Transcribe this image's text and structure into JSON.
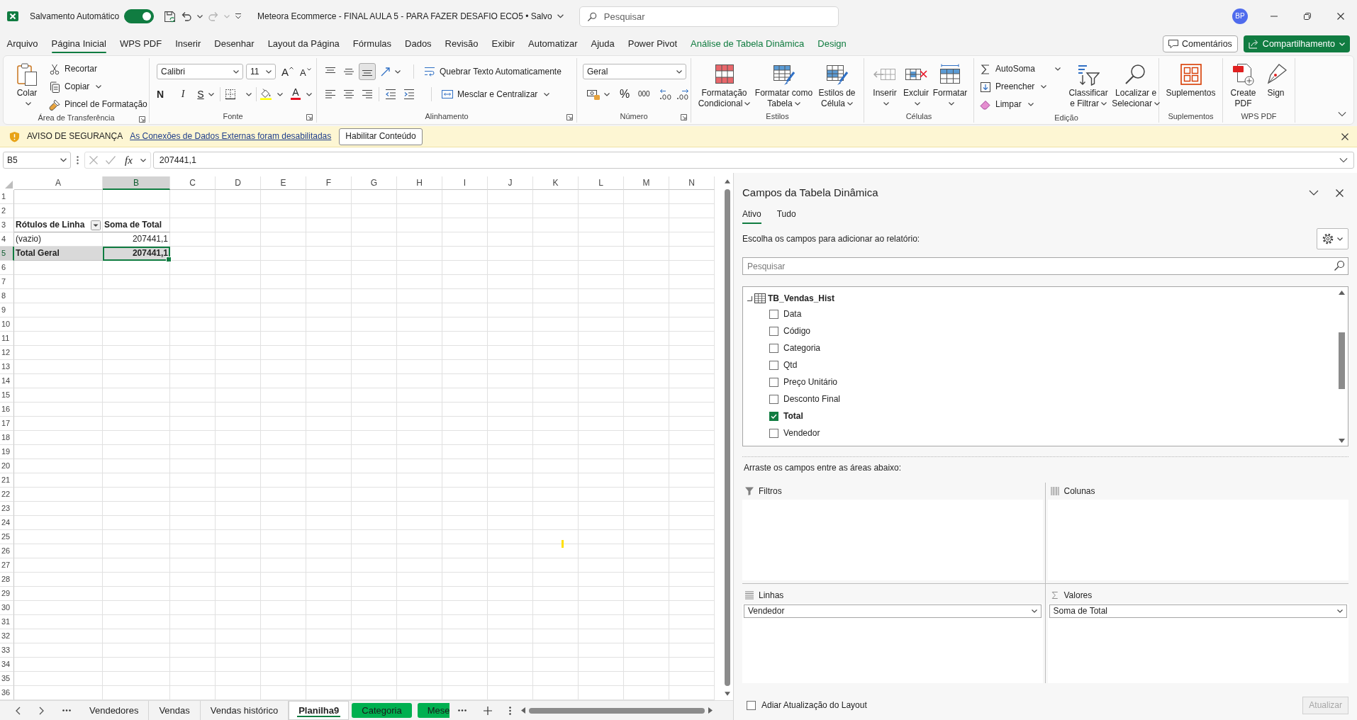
{
  "title_bar": {
    "autosave": {
      "label": "Salvamento Automático",
      "on": true
    },
    "redo": {
      "disabled": true
    },
    "document_title": "Meteora Ecommerce - FINAL AULA 5 - PARA FAZER DESAFIO ECO5 • Salvo",
    "search": {
      "placeholder": "Pesquisar"
    },
    "avatar": "BP"
  },
  "ribbon_tabs": [
    {
      "label": "Arquivo",
      "selected": false,
      "kind": "standard"
    },
    {
      "label": "Página Inicial",
      "selected": true,
      "kind": "standard"
    },
    {
      "label": "WPS PDF",
      "selected": false,
      "kind": "standard"
    },
    {
      "label": "Inserir",
      "selected": false,
      "kind": "standard"
    },
    {
      "label": "Desenhar",
      "selected": false,
      "kind": "standard"
    },
    {
      "label": "Layout da Página",
      "selected": false,
      "kind": "standard"
    },
    {
      "label": "Fórmulas",
      "selected": false,
      "kind": "standard"
    },
    {
      "label": "Dados",
      "selected": false,
      "kind": "standard"
    },
    {
      "label": "Revisão",
      "selected": false,
      "kind": "standard"
    },
    {
      "label": "Exibir",
      "selected": false,
      "kind": "standard"
    },
    {
      "label": "Automatizar",
      "selected": false,
      "kind": "standard"
    },
    {
      "label": "Ajuda",
      "selected": false,
      "kind": "standard"
    },
    {
      "label": "Power Pivot",
      "selected": false,
      "kind": "standard"
    },
    {
      "label": "Análise de Tabela Dinâmica",
      "selected": false,
      "kind": "contextual"
    },
    {
      "label": "Design",
      "selected": false,
      "kind": "contextual"
    }
  ],
  "ribbon_actions": [
    {
      "label": "Comentários",
      "kind": "outline"
    },
    {
      "label": "Compartilhamento",
      "kind": "primary"
    }
  ],
  "ribbon_groups": [
    {
      "kind": "clipboard",
      "label": "Área de Transferência",
      "items": [
        {
          "label": "Colar",
          "menu": true
        },
        {
          "label": "Recortar",
          "menu": false
        },
        {
          "label": "Copiar",
          "menu": true
        },
        {
          "label": "Pincel de Formatação",
          "menu": false
        }
      ]
    },
    {
      "kind": "font",
      "label": "Fonte",
      "font_name": "Calibri",
      "font_size": "11",
      "grow_font": "A",
      "shrink_font": "A",
      "bold": "N",
      "italic": "I",
      "underline": "S",
      "font_color": "A"
    },
    {
      "kind": "alignment",
      "label": "Alinhamento",
      "vertical_align": [
        {
          "selected": false
        },
        {
          "selected": false
        },
        {
          "selected": true
        }
      ],
      "items": [
        {
          "label": "Quebrar Texto Automaticamente",
          "menu": false
        },
        {
          "label": "Mesclar e Centralizar",
          "menu": true
        }
      ]
    },
    {
      "kind": "number",
      "label": "Número",
      "format": "Geral",
      "percent": "%",
      "thousands": "000"
    },
    {
      "kind": "styles",
      "label": "Estilos",
      "items": [
        {
          "label": "Formatação Condicional",
          "menu": true
        },
        {
          "label": "Formatar como Tabela",
          "menu": true
        },
        {
          "label": "Estilos de Célula",
          "menu": true
        }
      ]
    },
    {
      "kind": "cells",
      "label": "Células",
      "items": [
        {
          "label": "Inserir",
          "menu": true
        },
        {
          "label": "Excluir",
          "menu": true
        },
        {
          "label": "Formatar",
          "menu": true
        }
      ]
    },
    {
      "kind": "editing",
      "label": "Edição",
      "items": [
        {
          "label": "AutoSoma",
          "menu": true
        },
        {
          "label": "Preencher",
          "menu": true
        },
        {
          "label": "Limpar",
          "menu": true
        },
        {
          "label": "Classificar e Filtrar",
          "menu": true
        },
        {
          "label": "Localizar e Selecionar",
          "menu": true
        }
      ]
    },
    {
      "kind": "addins",
      "label": "Suplementos",
      "items": [
        {
          "label": "Suplementos",
          "menu": false
        }
      ]
    },
    {
      "kind": "pdf",
      "label": "WPS PDF",
      "items": [
        {
          "label": "Create PDF",
          "menu": false
        },
        {
          "label": "Sign",
          "menu": false
        }
      ]
    }
  ],
  "security_bar": {
    "title": "AVISO DE SEGURANÇA",
    "message": "As Conexões de Dados Externas foram desabilitadas",
    "button": "Habilitar Conteúdo"
  },
  "formula_bar": {
    "name_box": "B5",
    "function_label": "fx",
    "value": "207441,1"
  },
  "sheet": {
    "columns": [
      {
        "label": "A",
        "selected": false
      },
      {
        "label": "B",
        "selected": true
      },
      {
        "label": "C",
        "selected": false
      },
      {
        "label": "D",
        "selected": false
      },
      {
        "label": "E",
        "selected": false
      },
      {
        "label": "F",
        "selected": false
      },
      {
        "label": "G",
        "selected": false
      },
      {
        "label": "H",
        "selected": false
      },
      {
        "label": "I",
        "selected": false
      },
      {
        "label": "J",
        "selected": false
      },
      {
        "label": "K",
        "selected": false
      },
      {
        "label": "L",
        "selected": false
      },
      {
        "label": "M",
        "selected": false
      },
      {
        "label": "N",
        "selected": false
      }
    ],
    "rows": [
      {
        "label": "1",
        "selected": false
      },
      {
        "label": "2",
        "selected": false
      },
      {
        "label": "3",
        "selected": false
      },
      {
        "label": "4",
        "selected": false
      },
      {
        "label": "5",
        "selected": true
      },
      {
        "label": "6",
        "selected": false
      },
      {
        "label": "7",
        "selected": false
      },
      {
        "label": "8",
        "selected": false
      },
      {
        "label": "9",
        "selected": false
      },
      {
        "label": "10",
        "selected": false
      },
      {
        "label": "11",
        "selected": false
      },
      {
        "label": "12",
        "selected": false
      },
      {
        "label": "13",
        "selected": false
      },
      {
        "label": "14",
        "selected": false
      },
      {
        "label": "15",
        "selected": false
      },
      {
        "label": "16",
        "selected": false
      },
      {
        "label": "17",
        "selected": false
      },
      {
        "label": "18",
        "selected": false
      },
      {
        "label": "19",
        "selected": false
      },
      {
        "label": "20",
        "selected": false
      },
      {
        "label": "21",
        "selected": false
      },
      {
        "label": "22",
        "selected": false
      },
      {
        "label": "23",
        "selected": false
      },
      {
        "label": "24",
        "selected": false
      },
      {
        "label": "25",
        "selected": false
      },
      {
        "label": "26",
        "selected": false
      },
      {
        "label": "27",
        "selected": false
      },
      {
        "label": "28",
        "selected": false
      },
      {
        "label": "29",
        "selected": false
      },
      {
        "label": "30",
        "selected": false
      },
      {
        "label": "31",
        "selected": false
      },
      {
        "label": "32",
        "selected": false
      },
      {
        "label": "33",
        "selected": false
      },
      {
        "label": "34",
        "selected": false
      },
      {
        "label": "35",
        "selected": false
      },
      {
        "label": "36",
        "selected": false
      }
    ],
    "pivot_table": {
      "rows": [
        {
          "kind": "header",
          "cells": [
            {
              "text": "Rótulos de Linha",
              "selected": false
            },
            {
              "text": "Soma de Total",
              "selected": false
            }
          ]
        },
        {
          "kind": "item",
          "cells": [
            {
              "text": "(vazio)",
              "selected": false
            },
            {
              "text": "207441,1",
              "selected": false
            }
          ]
        },
        {
          "kind": "total",
          "cells": [
            {
              "text": "Total Geral",
              "selected": false
            },
            {
              "text": "207441,1",
              "selected": true
            }
          ]
        }
      ]
    }
  },
  "sheet_tabs": [
    {
      "label": "Vendedores",
      "selected": false
    },
    {
      "label": "Vendas",
      "selected": false
    },
    {
      "label": "Vendas histórico",
      "selected": false
    },
    {
      "label": "Planilha9",
      "selected": true
    },
    {
      "label": "Categoria",
      "selected": false,
      "color": "#00b050"
    },
    {
      "label": "Mese",
      "selected": false,
      "color": "#00b050"
    }
  ],
  "pivot_fields_pane": {
    "title": "Campos da Tabela Dinâmica",
    "tabs": [
      {
        "label": "Ativo",
        "selected": true
      },
      {
        "label": "Tudo",
        "selected": false
      }
    ],
    "instruction": "Escolha os campos para adicionar ao relatório:",
    "search": {
      "placeholder": "Pesquisar"
    },
    "field_tree": [
      {
        "label": "TB_Vendas_Hist",
        "expanded": true,
        "children": [
          {
            "label": "Data",
            "checked": false
          },
          {
            "label": "Código",
            "checked": false
          },
          {
            "label": "Categoria",
            "checked": false
          },
          {
            "label": "Qtd",
            "checked": false
          },
          {
            "label": "Preço Unitário",
            "checked": false
          },
          {
            "label": "Desconto Final",
            "checked": false
          },
          {
            "label": "Total",
            "checked": true
          },
          {
            "label": "Vendedor",
            "checked": false
          }
        ]
      }
    ],
    "areas_instruction": "Arraste os campos entre as áreas abaixo:",
    "areas": [
      {
        "kind": "filters",
        "label": "Filtros"
      },
      {
        "kind": "columns",
        "label": "Colunas"
      },
      {
        "kind": "rows",
        "label": "Linhas",
        "fields": [
          "Vendedor"
        ]
      },
      {
        "kind": "values",
        "label": "Valores",
        "fields": [
          "Soma de Total"
        ]
      }
    ],
    "defer_update": {
      "label": "Adiar Atualização do Layout",
      "checked": false
    },
    "update_button": {
      "label": "Atualizar",
      "disabled": true
    }
  }
}
